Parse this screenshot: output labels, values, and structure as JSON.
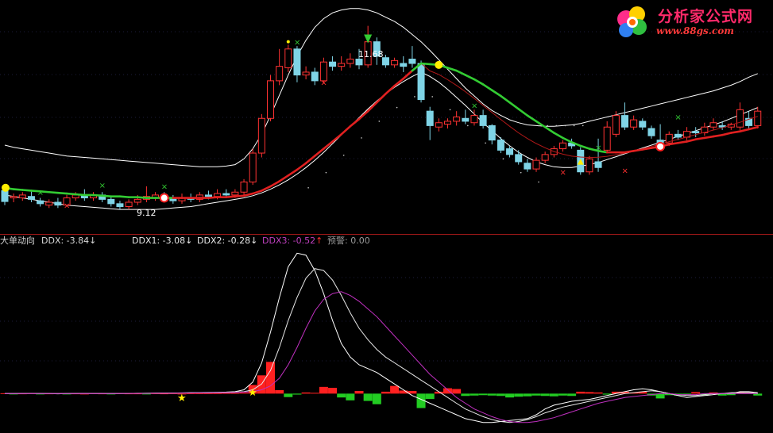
{
  "logo": {
    "title": "分析家公式网",
    "url": "www.88gs.com"
  },
  "readouts": {
    "indicator_name": "大单动向",
    "ddx": "DDX: -3.84",
    "ddx1": "DDX1: -3.08",
    "ddx2": "DDX2: -0.28",
    "ddx3": "DDX3: -0.52",
    "warn": "预警: 0.00",
    "down_arrow": "↓",
    "up_arrow": "↑"
  },
  "annotations": {
    "high_label": "11.68",
    "low_label": "9.12"
  },
  "colors": {
    "up_candle": "#ff3232",
    "down_candle": "#7fd4e6",
    "ma_up": "#e02020",
    "ma_down": "#33cc33",
    "band": "#ffffff",
    "ddx3": "#c030c0",
    "bar_pos": "#ff2020",
    "bar_neg": "#22cc22",
    "marker_yellow": "#ffee00"
  },
  "chart_data": [
    {
      "type": "candlestick",
      "title": "",
      "xlabel": "",
      "ylabel": "",
      "ylim": [
        8.9,
        11.95
      ],
      "high_marker": 11.68,
      "low_marker": 9.12,
      "candles": [
        [
          9.4,
          9.25,
          9.48,
          9.2
        ],
        [
          9.3,
          9.32,
          9.36,
          9.24
        ],
        [
          9.3,
          9.34,
          9.38,
          9.26
        ],
        [
          9.32,
          9.28,
          9.4,
          9.24
        ],
        [
          9.26,
          9.22,
          9.3,
          9.18
        ],
        [
          9.2,
          9.24,
          9.28,
          9.16
        ],
        [
          9.24,
          9.2,
          9.3,
          9.16
        ],
        [
          9.2,
          9.3,
          9.34,
          9.18
        ],
        [
          9.3,
          9.34,
          9.38,
          9.26
        ],
        [
          9.34,
          9.3,
          9.42,
          9.26
        ],
        [
          9.3,
          9.34,
          9.38,
          9.26
        ],
        [
          9.34,
          9.28,
          9.38,
          9.24
        ],
        [
          9.28,
          9.22,
          9.32,
          9.18
        ],
        [
          9.22,
          9.18,
          9.26,
          9.14
        ],
        [
          9.18,
          9.24,
          9.28,
          9.14
        ],
        [
          9.24,
          9.28,
          9.34,
          9.2
        ],
        [
          9.28,
          9.32,
          9.46,
          9.24
        ],
        [
          9.3,
          9.34,
          9.38,
          9.26
        ],
        [
          9.34,
          9.3,
          9.38,
          9.26
        ],
        [
          9.3,
          9.26,
          9.34,
          9.22
        ],
        [
          9.26,
          9.3,
          9.36,
          9.22
        ],
        [
          9.3,
          9.28,
          9.36,
          9.24
        ],
        [
          9.28,
          9.34,
          9.38,
          9.24
        ],
        [
          9.34,
          9.32,
          9.4,
          9.28
        ],
        [
          9.32,
          9.36,
          9.42,
          9.28
        ],
        [
          9.36,
          9.34,
          9.42,
          9.3
        ],
        [
          9.34,
          9.38,
          9.42,
          9.3
        ],
        [
          9.38,
          9.52,
          9.56,
          9.34
        ],
        [
          9.52,
          9.92,
          9.98,
          9.48
        ],
        [
          9.92,
          10.4,
          10.46,
          9.86
        ],
        [
          10.4,
          10.92,
          11.0,
          10.36
        ],
        [
          10.92,
          11.12,
          11.36,
          10.86
        ],
        [
          11.1,
          11.36,
          11.42,
          11.04
        ],
        [
          11.36,
          11.0,
          11.4,
          10.9
        ],
        [
          11.0,
          11.04,
          11.12,
          10.94
        ],
        [
          11.04,
          10.92,
          11.1,
          10.86
        ],
        [
          10.92,
          11.18,
          11.24,
          10.88
        ],
        [
          11.18,
          11.12,
          11.26,
          11.06
        ],
        [
          11.12,
          11.16,
          11.26,
          11.06
        ],
        [
          11.16,
          11.22,
          11.3,
          11.1
        ],
        [
          11.22,
          11.14,
          11.36,
          11.08
        ],
        [
          11.14,
          11.46,
          11.68,
          11.1
        ],
        [
          11.46,
          11.26,
          11.52,
          11.14
        ],
        [
          11.24,
          11.14,
          11.28,
          11.1
        ],
        [
          11.14,
          11.2,
          11.24,
          11.1
        ],
        [
          11.16,
          11.12,
          11.26,
          11.04
        ],
        [
          11.22,
          11.16,
          11.4,
          11.1
        ],
        [
          11.16,
          10.66,
          11.2,
          10.62
        ],
        [
          10.5,
          10.3,
          10.56,
          10.1
        ],
        [
          10.28,
          10.34,
          10.4,
          10.22
        ],
        [
          10.32,
          10.36,
          10.4,
          10.26
        ],
        [
          10.36,
          10.42,
          10.5,
          10.3
        ],
        [
          10.4,
          10.36,
          10.52,
          10.32
        ],
        [
          10.34,
          10.44,
          10.52,
          10.3
        ],
        [
          10.44,
          10.3,
          10.52,
          10.26
        ],
        [
          10.3,
          10.1,
          10.32,
          10.04
        ],
        [
          10.1,
          9.96,
          10.14,
          9.92
        ],
        [
          9.98,
          9.9,
          10.02,
          9.86
        ],
        [
          9.9,
          9.8,
          9.96,
          9.76
        ],
        [
          9.78,
          9.7,
          9.84,
          9.66
        ],
        [
          9.7,
          9.82,
          9.86,
          9.66
        ],
        [
          9.82,
          9.9,
          9.94,
          9.78
        ],
        [
          9.9,
          9.98,
          10.02,
          9.86
        ],
        [
          9.98,
          10.06,
          10.1,
          9.94
        ],
        [
          10.06,
          10.02,
          10.12,
          9.98
        ],
        [
          9.96,
          9.66,
          10.0,
          9.62
        ],
        [
          9.66,
          9.84,
          9.88,
          9.62
        ],
        [
          9.8,
          9.72,
          10.12,
          9.66
        ],
        [
          9.96,
          10.28,
          10.36,
          9.92
        ],
        [
          10.18,
          10.44,
          10.5,
          10.14
        ],
        [
          10.44,
          10.28,
          10.62,
          10.24
        ],
        [
          10.28,
          10.38,
          10.44,
          10.24
        ],
        [
          10.36,
          10.28,
          10.4,
          10.24
        ],
        [
          10.26,
          10.16,
          10.3,
          10.12
        ],
        [
          10.1,
          10.02,
          10.32,
          9.98
        ],
        [
          10.06,
          10.18,
          10.22,
          10.02
        ],
        [
          10.18,
          10.14,
          10.24,
          10.1
        ],
        [
          10.14,
          10.22,
          10.28,
          10.1
        ],
        [
          10.22,
          10.2,
          10.28,
          10.14
        ],
        [
          10.2,
          10.28,
          10.34,
          10.16
        ],
        [
          10.28,
          10.34,
          10.4,
          10.24
        ],
        [
          10.3,
          10.28,
          10.36,
          10.24
        ],
        [
          10.28,
          10.32,
          10.34,
          10.24
        ],
        [
          10.28,
          10.52,
          10.62,
          10.24
        ],
        [
          10.4,
          10.3,
          10.5,
          10.26
        ],
        [
          10.3,
          10.5,
          10.56,
          10.26
        ]
      ],
      "ma_line": [
        9.44,
        9.42,
        9.41,
        9.4,
        9.39,
        9.38,
        9.37,
        9.36,
        9.35,
        9.34,
        9.34,
        9.33,
        9.32,
        9.32,
        9.31,
        9.31,
        9.3,
        9.3,
        9.3,
        9.3,
        9.3,
        9.3,
        9.3,
        9.3,
        9.31,
        9.31,
        9.32,
        9.33,
        9.36,
        9.4,
        9.46,
        9.53,
        9.61,
        9.69,
        9.78,
        9.88,
        9.98,
        10.08,
        10.18,
        10.29,
        10.39,
        10.5,
        10.62,
        10.74,
        10.85,
        10.95,
        11.06,
        11.16,
        11.15,
        11.14,
        11.1,
        11.06,
        11.0,
        10.94,
        10.87,
        10.79,
        10.71,
        10.62,
        10.53,
        10.44,
        10.36,
        10.28,
        10.2,
        10.13,
        10.07,
        10.02,
        9.98,
        9.95,
        9.93,
        9.93,
        9.93,
        9.95,
        9.97,
        9.99,
        10.01,
        10.04,
        10.06,
        10.08,
        10.11,
        10.13,
        10.15,
        10.17,
        10.2,
        10.22,
        10.25,
        10.28
      ],
      "ma_green_ranges": [
        [
          0,
          19
        ],
        [
          47,
          68
        ]
      ],
      "upper_band": [
        10.03,
        10.0,
        9.98,
        9.96,
        9.94,
        9.92,
        9.9,
        9.88,
        9.87,
        9.86,
        9.85,
        9.84,
        9.83,
        9.82,
        9.81,
        9.8,
        9.79,
        9.78,
        9.77,
        9.76,
        9.75,
        9.74,
        9.73,
        9.73,
        9.73,
        9.74,
        9.76,
        9.84,
        9.98,
        10.18,
        10.44,
        10.72,
        11.0,
        11.26,
        11.48,
        11.66,
        11.78,
        11.86,
        11.9,
        11.92,
        11.92,
        11.9,
        11.86,
        11.8,
        11.74,
        11.66,
        11.56,
        11.46,
        11.34,
        11.21,
        11.08,
        10.95,
        10.82,
        10.71,
        10.6,
        10.51,
        10.44,
        10.38,
        10.34,
        10.31,
        10.3,
        10.29,
        10.29,
        10.3,
        10.31,
        10.33,
        10.36,
        10.39,
        10.42,
        10.45,
        10.48,
        10.51,
        10.54,
        10.57,
        10.6,
        10.63,
        10.66,
        10.69,
        10.72,
        10.75,
        10.78,
        10.82,
        10.86,
        10.91,
        10.97,
        11.02
      ],
      "lower_band": [
        9.34,
        9.32,
        9.3,
        9.28,
        9.26,
        9.24,
        9.22,
        9.2,
        9.19,
        9.18,
        9.17,
        9.16,
        9.15,
        9.14,
        9.14,
        9.14,
        9.14,
        9.14,
        9.15,
        9.16,
        9.17,
        9.18,
        9.2,
        9.22,
        9.24,
        9.26,
        9.28,
        9.3,
        9.33,
        9.37,
        9.42,
        9.48,
        9.55,
        9.63,
        9.72,
        9.82,
        9.93,
        10.05,
        10.17,
        10.29,
        10.41,
        10.53,
        10.64,
        10.74,
        10.83,
        10.91,
        10.98,
        11.04,
        10.98,
        10.9,
        10.8,
        10.69,
        10.58,
        10.46,
        10.34,
        10.23,
        10.12,
        10.02,
        9.93,
        9.86,
        9.8,
        9.76,
        9.73,
        9.72,
        9.72,
        9.74,
        9.76,
        9.79,
        9.83,
        9.87,
        9.91,
        9.95,
        9.99,
        10.03,
        10.07,
        10.11,
        10.15,
        10.19,
        10.23,
        10.27,
        10.31,
        10.35,
        10.4,
        10.45,
        10.5,
        10.55
      ]
    },
    {
      "type": "line",
      "title": "",
      "xlabel": "",
      "ylabel": "",
      "ylim": [
        -1.8,
        7.6
      ],
      "series": [
        {
          "name": "DDX1",
          "values": [
            0.0,
            0.0,
            0.01,
            0.01,
            0.0,
            0.0,
            -0.01,
            0.0,
            0.01,
            0.01,
            0.0,
            0.0,
            0.0,
            0.01,
            0.01,
            0.02,
            0.02,
            0.03,
            0.03,
            0.03,
            0.04,
            0.05,
            0.05,
            0.06,
            0.07,
            0.08,
            0.1,
            0.2,
            0.6,
            1.6,
            3.2,
            5.0,
            6.6,
            7.3,
            7.2,
            6.4,
            5.2,
            3.8,
            2.6,
            1.9,
            1.5,
            1.3,
            1.1,
            0.8,
            0.5,
            0.2,
            -0.1,
            -0.3,
            -0.5,
            -0.7,
            -0.9,
            -1.1,
            -1.3,
            -1.4,
            -1.5,
            -1.5,
            -1.45,
            -1.4,
            -1.35,
            -1.3,
            -1.1,
            -0.8,
            -0.6,
            -0.5,
            -0.4,
            -0.35,
            -0.3,
            -0.2,
            -0.1,
            0.0,
            0.1,
            0.2,
            0.25,
            0.2,
            0.1,
            0.0,
            -0.1,
            -0.2,
            -0.15,
            -0.1,
            -0.05,
            0.0,
            0.0,
            0.1,
            0.1,
            0.05
          ]
        },
        {
          "name": "DDX2",
          "values": [
            0.0,
            0.0,
            0.0,
            0.01,
            0.01,
            0.0,
            0.0,
            0.0,
            0.0,
            0.01,
            0.01,
            0.01,
            0.0,
            0.0,
            0.01,
            0.01,
            0.02,
            0.02,
            0.02,
            0.03,
            0.03,
            0.04,
            0.04,
            0.05,
            0.06,
            0.07,
            0.08,
            0.1,
            0.2,
            0.5,
            1.2,
            2.4,
            3.8,
            5.0,
            6.0,
            6.5,
            6.4,
            5.9,
            5.1,
            4.2,
            3.4,
            2.8,
            2.3,
            1.9,
            1.6,
            1.3,
            1.0,
            0.7,
            0.4,
            0.1,
            -0.2,
            -0.5,
            -0.8,
            -1.0,
            -1.2,
            -1.35,
            -1.45,
            -1.5,
            -1.45,
            -1.35,
            -1.2,
            -1.0,
            -0.85,
            -0.7,
            -0.6,
            -0.5,
            -0.4,
            -0.3,
            -0.2,
            -0.1,
            0.0,
            0.05,
            0.1,
            0.15,
            0.1,
            0.0,
            -0.05,
            -0.1,
            -0.1,
            -0.05,
            0.0,
            0.0,
            0.05,
            0.05,
            0.05,
            0.0
          ]
        },
        {
          "name": "DDX3",
          "values": [
            0.0,
            0.0,
            0.0,
            0.0,
            0.0,
            0.0,
            0.0,
            0.0,
            0.0,
            0.0,
            0.0,
            0.0,
            0.0,
            0.01,
            0.01,
            0.01,
            0.01,
            0.02,
            0.02,
            0.02,
            0.03,
            0.03,
            0.04,
            0.04,
            0.05,
            0.05,
            0.06,
            0.08,
            0.1,
            0.2,
            0.4,
            0.8,
            1.5,
            2.4,
            3.4,
            4.3,
            4.9,
            5.2,
            5.3,
            5.1,
            4.8,
            4.4,
            4.0,
            3.5,
            3.0,
            2.5,
            2.0,
            1.5,
            1.0,
            0.6,
            0.2,
            -0.2,
            -0.5,
            -0.8,
            -1.0,
            -1.2,
            -1.35,
            -1.45,
            -1.5,
            -1.5,
            -1.45,
            -1.35,
            -1.25,
            -1.1,
            -0.95,
            -0.8,
            -0.65,
            -0.5,
            -0.4,
            -0.3,
            -0.2,
            -0.15,
            -0.1,
            -0.05,
            0.0,
            0.0,
            -0.05,
            -0.05,
            -0.05,
            0.0,
            0.0,
            0.0,
            0.0,
            0.0,
            0.0,
            0.0
          ]
        }
      ],
      "bars": [
        0.02,
        -0.02,
        0.01,
        0.02,
        -0.01,
        0.01,
        0.02,
        -0.02,
        0.01,
        0.0,
        0.02,
        0.01,
        -0.01,
        0.02,
        0.01,
        0.01,
        -0.02,
        0.02,
        0.01,
        0.02,
        0.0,
        0.02,
        0.02,
        0.02,
        0.02,
        0.03,
        0.03,
        0.05,
        0.45,
        0.95,
        1.65,
        0.18,
        -0.18,
        -0.05,
        0.06,
        0.04,
        0.35,
        0.3,
        -0.2,
        -0.35,
        0.14,
        -0.38,
        -0.55,
        0.1,
        0.4,
        0.16,
        0.14,
        -0.75,
        -0.28,
        0.1,
        0.28,
        0.24,
        -0.12,
        -0.1,
        -0.08,
        -0.1,
        -0.12,
        -0.2,
        -0.16,
        -0.14,
        -0.1,
        -0.12,
        -0.14,
        -0.1,
        -0.12,
        0.1,
        0.08,
        0.06,
        -0.05,
        0.1,
        0.1,
        0.06,
        0.1,
        -0.1,
        -0.25,
        -0.08,
        -0.1,
        -0.06,
        0.08,
        -0.08,
        0.06,
        -0.1,
        -0.08,
        0.08,
        0.06,
        -0.1
      ],
      "zero_level": 0
    }
  ]
}
